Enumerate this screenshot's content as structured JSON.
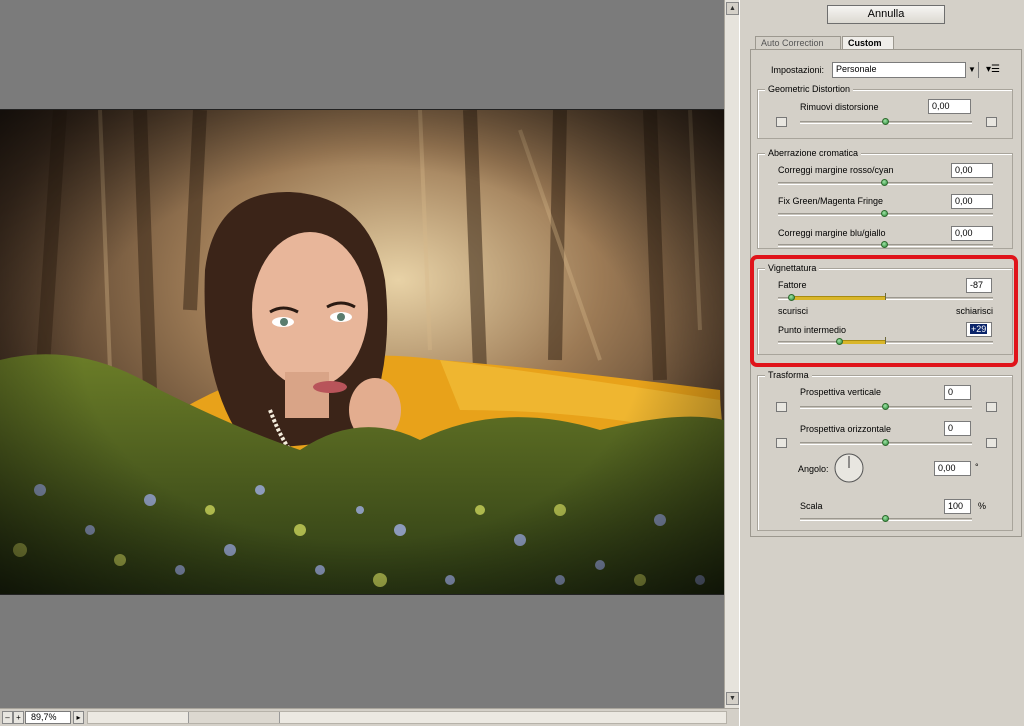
{
  "canvas": {
    "zoom": "89,7%"
  },
  "panel": {
    "cancel_label": "Annulla",
    "tabs": [
      {
        "label": "Auto Correction"
      },
      {
        "label": "Custom"
      }
    ],
    "settings": {
      "label": "Impostazioni:",
      "value": "Personale"
    },
    "geometric": {
      "title": "Geometric Distortion",
      "remove_label": "Rimuovi distorsione",
      "remove_value": "0,00"
    },
    "chromatic": {
      "title": "Aberrazione cromatica",
      "items": [
        {
          "label": "Correggi margine rosso/cyan",
          "value": "0,00"
        },
        {
          "label": "Fix Green/Magenta Fringe",
          "value": "0,00"
        },
        {
          "label": "Correggi margine blu/giallo",
          "value": "0,00"
        }
      ]
    },
    "vignette": {
      "title": "Vignettatura",
      "amount_label": "Fattore",
      "amount_value": "-87",
      "darken_label": "scurisci",
      "lighten_label": "schiarisci",
      "midpoint_label": "Punto intermedio",
      "midpoint_value": "+29"
    },
    "transform": {
      "title": "Trasforma",
      "vertical_label": "Prospettiva verticale",
      "vertical_value": "0",
      "horizontal_label": "Prospettiva orizzontale",
      "horizontal_value": "0",
      "angle_label": "Angolo:",
      "angle_value": "0,00",
      "angle_unit": "°",
      "scale_label": "Scala",
      "scale_value": "100",
      "scale_unit": "%"
    }
  },
  "colors": {
    "highlight": "#e0141b",
    "slider_fill": "#d9b62a",
    "thumb": "#2b8b3a"
  }
}
